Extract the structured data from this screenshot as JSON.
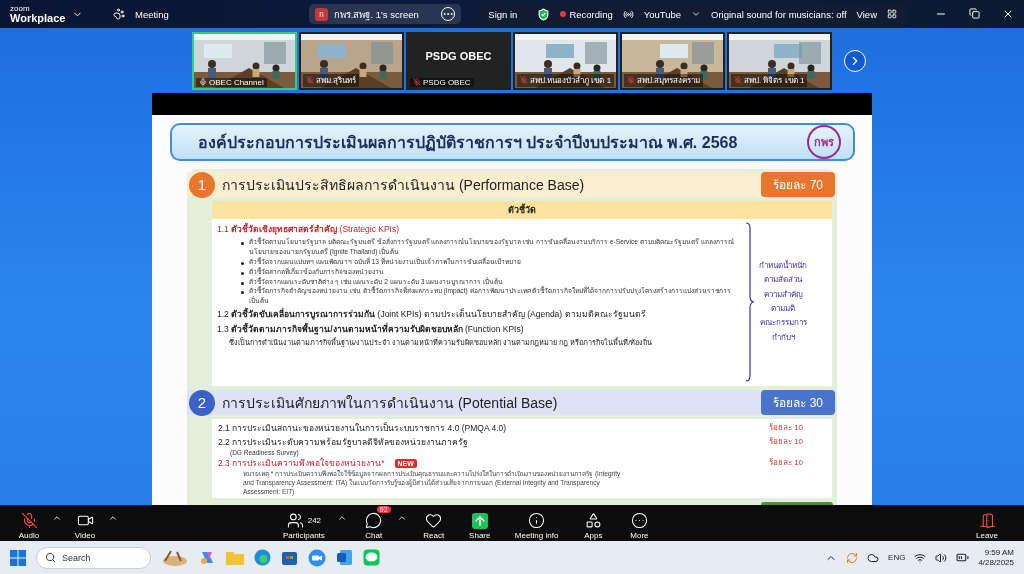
{
  "top_bar": {
    "brand": "zoom",
    "product": "Workplace",
    "meeting_label": "Meeting",
    "share_avatar": "ก",
    "share_title": "กพร.สพฐ. 1's screen",
    "sign_in": "Sign in",
    "recording": "Recording",
    "stream": "YouTube",
    "original_sound": "Original sound for musicians: off",
    "view": "View"
  },
  "gallery": [
    {
      "kind": "video",
      "name": "OBEC Channel",
      "active": true,
      "muted": false
    },
    {
      "kind": "video",
      "name": "สพม.สุรินทร์",
      "active": false,
      "muted": true
    },
    {
      "kind": "name_card",
      "display": "PSDG OBEC",
      "name": "PSDG OBEC",
      "active": false,
      "muted": true
    },
    {
      "kind": "video",
      "name": "สพป.หนองบัวลำภู เขต 1",
      "active": false,
      "muted": true
    },
    {
      "kind": "video",
      "name": "สพป.สมุทรสงคราม",
      "active": false,
      "muted": true
    },
    {
      "kind": "video",
      "name": "สพป. พิจิตร เขต 1",
      "active": false,
      "muted": true
    }
  ],
  "slide": {
    "title": "องค์ประกอบการประเมินผลการปฏิบัติราชการฯ ประจำปีงบประมาณ พ.ศ. 2568",
    "logo": "กพร",
    "section_1": {
      "number": "1",
      "title": "การประเมินประสิทธิผลการดำเนินงาน (Performance Base)",
      "weight": "ร้อยละ 70",
      "column_header": "ตัวชี้วัด",
      "items": [
        {
          "kind": "highlight",
          "label": "1.1 **ตัวชี้วัดเชิงยุทธศาสตร์สำคัญ** (Strategic KPIs)",
          "bullets": [
            "ตัวชี้วัดตามนโยบายรัฐบาล มติคณะรัฐมนตรี ข้อสั่งการรัฐมนตรี แถลงการณ์นโยบายของรัฐบาล เช่น การขับเคลื่อนงานบริการ e-Service ตามมติคณะรัฐมนตรี แถลงการณ์นโยบายของนายกรัฐมนตรี (Ignite Thailand) เป็นต้น",
            "ตัวชี้วัดจากแผนแม่บทฯ แผนพัฒนาฯ ฉบับที่ 13 ที่หน่วยงานเป็นเจ้าภาพในการขับเคลื่อนเป้าหมาย",
            "ตัวชี้วัดสากลที่เกี่ยวข้องกับภารกิจของหน่วยงาน",
            "ตัวชี้วัดจากแผนระดับชาติต่าง ๆ เช่น แผนระดับ 2 แผนระดับ 3 แผนงานบูรณาการ เป็นต้น",
            "ตัวชี้วัดภารกิจสำคัญของหน่วยงาน เช่น ตัวชี้วัดภารกิจที่ส่งผลกระทบ (Impact) ต่อการพัฒนาประเทศ ตัวชี้วัดภารกิจใหม่ที่ได้จากการปรับปรุงโครงสร้างการแบ่งส่วนราชการ เป็นต้น"
          ]
        },
        {
          "kind": "plain",
          "label": "1.2 **ตัวชี้วัดขับเคลื่อนการบูรณาการร่วมกัน** (Joint KPIs) ตามประเด็นนโยบายสำคัญ (Agenda) ตามมติคณะรัฐมนตรี"
        },
        {
          "kind": "plain",
          "label": "1.3 **ตัวชี้วัดตามภารกิจพื้นฐาน/งานตามหน้าที่ความรับผิดชอบหลัก** (Function KPIs)",
          "description": "ซึ่งเป็นการดำเนินงานตามภารกิจพื้นฐาน/งานประจำ งานตามหน้าที่ความรับผิดชอบหลัก งานตามกฎหมาย กฎ หรือภารกิจในพื้นที่/ท้องถิ่น"
        }
      ],
      "note_lines": [
        "กำหนดน้ำหนัก",
        "ตามสัดส่วน",
        "ความสำคัญ",
        "ตามมติ",
        "คณะกรรมการ",
        "กำกับฯ"
      ]
    },
    "section_2": {
      "number": "2",
      "title": "การประเมินศักยภาพในการดำเนินงาน (Potential Base)",
      "weight": "ร้อยละ 30",
      "items": [
        {
          "kind": "plain",
          "label": "2.1 การประเมินสถานะของหน่วยงานในการเป็นระบบราชการ 4.0 (PMQA 4.0)",
          "weight": "ร้อยละ 10"
        },
        {
          "kind": "plain",
          "label": "2.2 การประเมินระดับความพร้อมรัฐบาลดิจิทัลของหน่วยงานภาครัฐ",
          "sub": "(DG Readiness Survey)",
          "weight": "ร้อยละ 10"
        },
        {
          "kind": "highlight",
          "label": "2.3 การประเมินความพึงพอใจของหน่วยงาน*",
          "tag": "NEW",
          "weight": "ร้อยละ 10",
          "footnote": "หมายเหตุ * การประเมินความพึงพอใจใช้ข้อมูลจากผลการประเมินคุณธรรมและความโปร่งใสในการดำเนินงานของหน่วยงานภาครัฐ (Integrity and Transparency Assessment: ITA) ในแบบวัดการรับรู้ของผู้มีส่วนได้ส่วนเสียจากภายนอก (External Integrity and Transparency Assessment: EIT)"
        }
      ]
    }
  },
  "toolbar": {
    "left": [
      {
        "kind": "audio",
        "label": "Audio",
        "muted": true,
        "caret": true
      },
      {
        "kind": "video",
        "label": "Video",
        "muted": false,
        "caret": true
      }
    ],
    "center": [
      {
        "kind": "participants",
        "label": "Participants",
        "count": "242",
        "caret": true
      },
      {
        "kind": "chat",
        "label": "Chat",
        "badge": "92",
        "caret": true
      },
      {
        "kind": "react",
        "label": "React",
        "caret": false
      },
      {
        "kind": "share",
        "label": "Share",
        "caret": false
      },
      {
        "kind": "info",
        "label": "Meeting info",
        "caret": false
      },
      {
        "kind": "apps",
        "label": "Apps",
        "caret": false
      },
      {
        "kind": "more",
        "label": "More",
        "caret": false
      }
    ],
    "leave": "Leave"
  },
  "taskbar": {
    "search_placeholder": "Search",
    "language": "ENG",
    "time": "9:59 AM",
    "date": "4/28/2025"
  }
}
